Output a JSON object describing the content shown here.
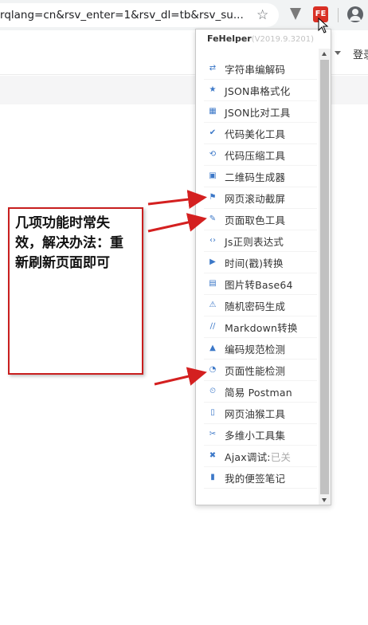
{
  "browser": {
    "url": "rqlang=cn&rsv_enter=1&rsv_dl=tb&rsv_su...",
    "bookmark_icon": "star-icon",
    "extension_icon": "vpn-v-icon",
    "fehelper_button_label": "FE",
    "profile_icon": "account-icon"
  },
  "page": {
    "login_label": "登录"
  },
  "popup": {
    "brand": "FeHelper",
    "version": "(V2019.9.3201)",
    "items": [
      {
        "icon": "⇄",
        "label": "字符串编解码"
      },
      {
        "icon": "★",
        "label": "JSON串格式化"
      },
      {
        "icon": "▦",
        "label": "JSON比对工具"
      },
      {
        "icon": "✔",
        "label": "代码美化工具"
      },
      {
        "icon": "⟲",
        "label": "代码压缩工具"
      },
      {
        "icon": "▣",
        "label": "二维码生成器"
      },
      {
        "icon": "⚑",
        "label": "网页滚动截屏"
      },
      {
        "icon": "✎",
        "label": "页面取色工具"
      },
      {
        "icon": "‹›",
        "label": "Js正则表达式"
      },
      {
        "icon": "▶",
        "label": "时间(戳)转换"
      },
      {
        "icon": "▤",
        "label": "图片转Base64"
      },
      {
        "icon": "⚠",
        "label": "随机密码生成"
      },
      {
        "icon": "∕∕",
        "label": "Markdown转换"
      },
      {
        "icon": "▲",
        "label": "编码规范检测"
      },
      {
        "icon": "◔",
        "label": "页面性能检测"
      },
      {
        "icon": "⏲",
        "label": "简易 Postman"
      },
      {
        "icon": "▯",
        "label": "网页油猴工具"
      },
      {
        "icon": "✂",
        "label": "多维小工具集"
      },
      {
        "icon": "✖",
        "label": "Ajax调试:",
        "suffix": "已关"
      },
      {
        "icon": "▮",
        "label": "我的便签笔记"
      }
    ]
  },
  "annotation": {
    "text": "几项功能时常失效，解决办法：重新刷新页面即可",
    "color": "#c81e1e"
  },
  "colors": {
    "icon_blue": "#3c78c8",
    "arrow_red": "#d42020"
  }
}
